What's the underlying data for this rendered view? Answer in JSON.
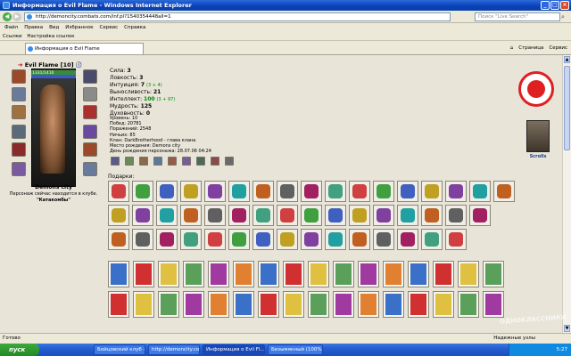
{
  "window": {
    "title": "Информация о Evil Flame - Windows Internet Explorer"
  },
  "address": {
    "url": "http://demoncity.combats.com/inf.pl?1540354448all=1",
    "search_placeholder": "Поиск \"Live Search\""
  },
  "menu": [
    "Файл",
    "Правка",
    "Вид",
    "Избранное",
    "Сервис",
    "Справка"
  ],
  "links": {
    "label": "Ссылки",
    "item": "Настройка ссылок"
  },
  "tab": {
    "label": "Информация о Evil Flame"
  },
  "toolbar_right": [
    "Страница",
    "Сервис"
  ],
  "character": {
    "name": "Evil Flame",
    "level": "[10]",
    "hp": "1331/1410",
    "city": "Demons city",
    "club_line": "Персонаж сейчас находится в клубе.",
    "club_place": "\"Катакомбы\""
  },
  "stats": [
    {
      "label": "Сила:",
      "value": "3",
      "bonus": ""
    },
    {
      "label": "Ловкость:",
      "value": "3",
      "bonus": ""
    },
    {
      "label": "Интуиция:",
      "value": "7",
      "bonus": "(3 + 4)"
    },
    {
      "label": "Выносливость:",
      "value": "21",
      "bonus": ""
    },
    {
      "label": "Интеллект:",
      "value": "100",
      "bonus": "(3 + 97)"
    },
    {
      "label": "Мудрость:",
      "value": "125",
      "bonus": ""
    },
    {
      "label": "Духовность:",
      "value": "0",
      "bonus": ""
    }
  ],
  "info": [
    "Уровень: 10",
    "Побед: 20781",
    "Поражений: 2548",
    "Ничьих: 85",
    "Клан: DarkBrotherhood - глава клана",
    "Место рождения: Demons city",
    "День рождения персонажа: 28.07.06 04:24"
  ],
  "gifts_label": "Подарки:",
  "scrolls_label": "Scrolls",
  "status": {
    "left": "Готово",
    "right": "Надежные узлы"
  },
  "taskbar": {
    "start": "пуск",
    "items": [
      "Бойцовский клуб - ...",
      "http://demoncity.co...",
      "Информация о Evil Fl...",
      "Безымянный (100%)..."
    ],
    "time": "5:27"
  },
  "watermark": "ОДНОКЛАССНИКИ"
}
